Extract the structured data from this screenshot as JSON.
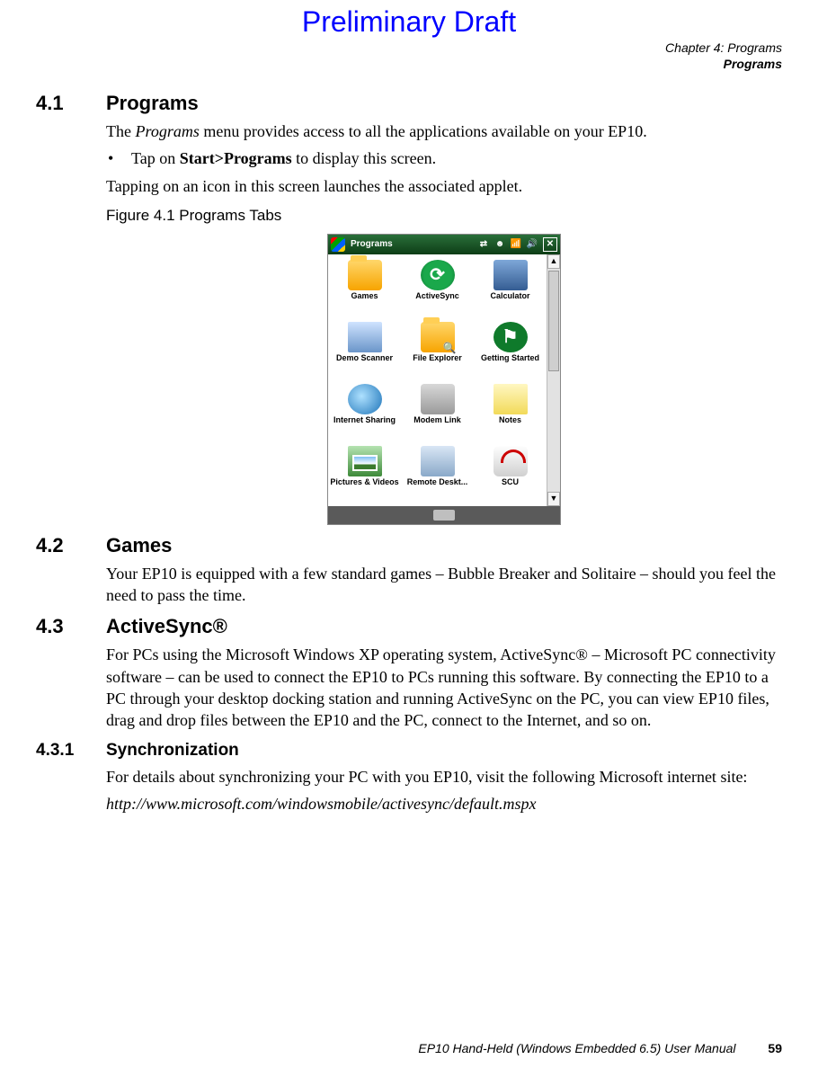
{
  "watermark": "Preliminary Draft",
  "header": {
    "chapter": "Chapter 4:  Programs",
    "section": "Programs"
  },
  "sections": {
    "s41": {
      "num": "4.1",
      "title": "Programs",
      "p1a": "The ",
      "p1b": "Programs",
      "p1c": " menu provides access to all the applications available on your EP10.",
      "bullet_a": "Tap on ",
      "bullet_b": "Start>Programs",
      "bullet_c": " to display this screen.",
      "p2": "Tapping on an icon in this screen launches the associated applet.",
      "fig": "Figure 4.1  Programs Tabs"
    },
    "s42": {
      "num": "4.2",
      "title": "Games",
      "p1": "Your EP10 is equipped with a few standard games – Bubble Breaker and Solitaire – should you feel the need to pass the time."
    },
    "s43": {
      "num": "4.3",
      "title": "ActiveSync®",
      "p1": "For PCs using the Microsoft Windows XP operating system, ActiveSync® – Microsoft PC connectivity software – can be used to connect the EP10 to PCs running this software. By connecting the EP10 to a PC through your desktop docking station and running ActiveSync on the PC, you can view EP10 files, drag and drop files between the EP10 and the PC, connect to the Internet, and so on."
    },
    "s431": {
      "num": "4.3.1",
      "title": "Synchronization",
      "p1": "For details about synchronizing your PC with you EP10, visit the following Microsoft internet site:",
      "url": "http://www.microsoft.com/windowsmobile/activesync/default.mspx"
    }
  },
  "device": {
    "title": "Programs",
    "status_icons": [
      "⇄",
      "☻",
      "📶",
      "🔊",
      "✕"
    ],
    "apps": [
      {
        "label": "Games"
      },
      {
        "label": "ActiveSync"
      },
      {
        "label": "Calculator"
      },
      {
        "label": "Demo Scanner"
      },
      {
        "label": "File Explorer"
      },
      {
        "label": "Getting Started"
      },
      {
        "label": "Internet Sharing"
      },
      {
        "label": "Modem Link"
      },
      {
        "label": "Notes"
      },
      {
        "label": "Pictures & Videos"
      },
      {
        "label": "Remote Deskt..."
      },
      {
        "label": "SCU"
      }
    ]
  },
  "footer": {
    "manual": "EP10 Hand-Held (Windows Embedded 6.5) User Manual",
    "page": "59"
  }
}
